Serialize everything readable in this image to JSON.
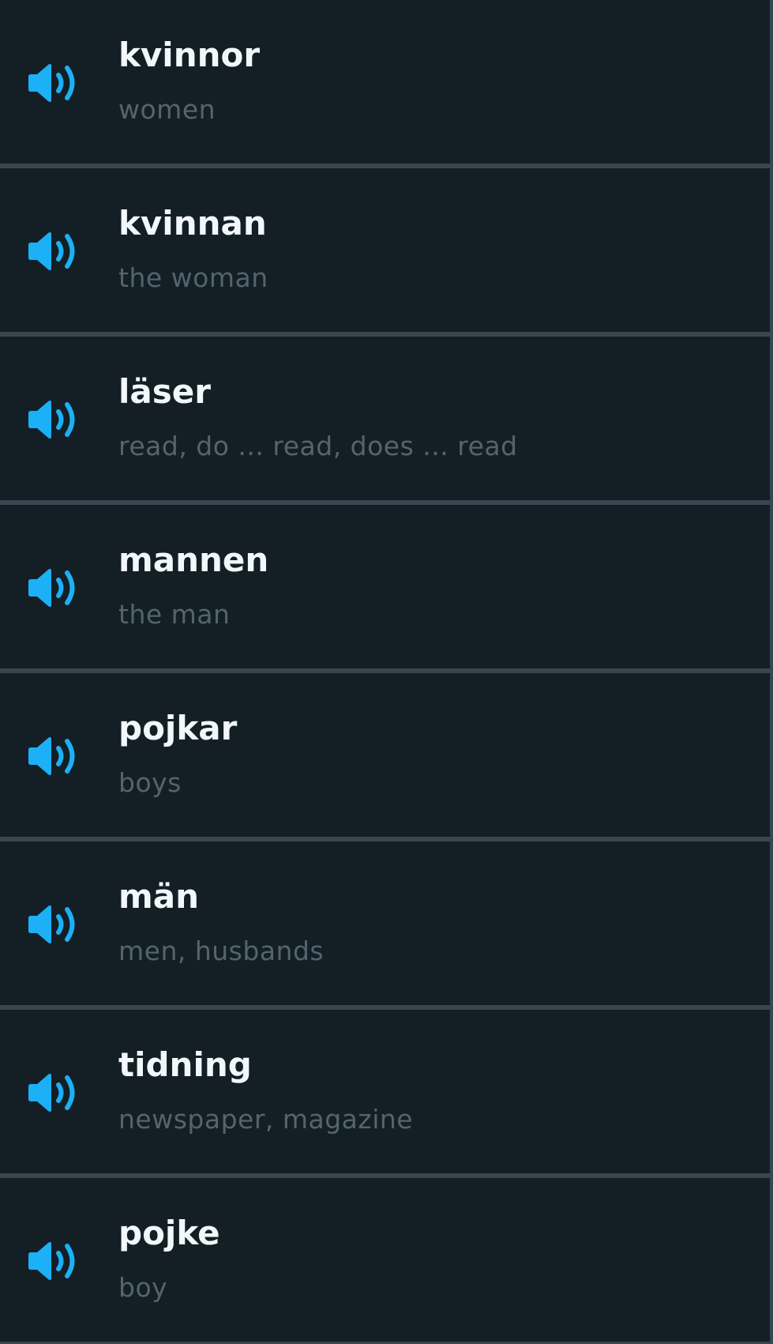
{
  "colors": {
    "background": "#131f24",
    "divider": "#37464f",
    "word": "#f1f7fb",
    "translation": "#52656d",
    "speaker": "#1cb0f6"
  },
  "vocabulary": {
    "items": [
      {
        "word": "kvinnor",
        "translation": "women",
        "icon": "speaker-icon"
      },
      {
        "word": "kvinnan",
        "translation": "the woman",
        "icon": "speaker-icon"
      },
      {
        "word": "läser",
        "translation": "read, do ... read, does ... read",
        "icon": "speaker-icon"
      },
      {
        "word": "mannen",
        "translation": "the man",
        "icon": "speaker-icon"
      },
      {
        "word": "pojkar",
        "translation": "boys",
        "icon": "speaker-icon"
      },
      {
        "word": "män",
        "translation": "men, husbands",
        "icon": "speaker-icon"
      },
      {
        "word": "tidning",
        "translation": "newspaper, magazine",
        "icon": "speaker-icon"
      },
      {
        "word": "pojke",
        "translation": "boy",
        "icon": "speaker-icon"
      }
    ]
  }
}
